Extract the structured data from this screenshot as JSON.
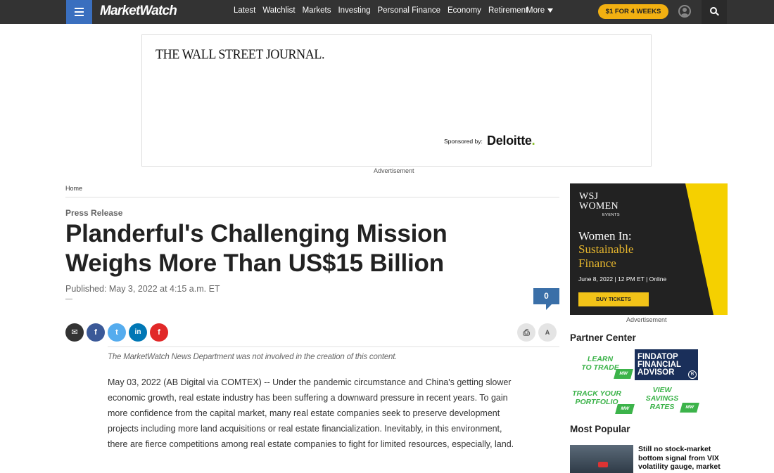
{
  "header": {
    "logo": "MarketWatch",
    "nav": [
      "Latest",
      "Watchlist",
      "Markets",
      "Investing",
      "Personal Finance",
      "Economy",
      "Retirement"
    ],
    "more_label": "More",
    "promo_label": "$1 FOR 4 WEEKS"
  },
  "top_ad": {
    "publisher": "THE WALL STREET JOURNAL.",
    "sponsored_by": "Sponsored by:",
    "sponsor": "Deloitte",
    "sponsor_dot": ".",
    "label": "Advertisement"
  },
  "article": {
    "breadcrumb": "Home",
    "kicker": "Press Release",
    "headline": "Planderful's Challenging Mission Weighs More Than US$15 Billion",
    "published": "Published: May 3, 2022 at 4:15 a.m. ET",
    "comment_count": "0",
    "share": {
      "email": "✉",
      "facebook": "f",
      "twitter": "t",
      "linkedin": "in",
      "flipboard": "f"
    },
    "tools": {
      "print": "⎙",
      "text_size": "A"
    },
    "disclaimer": "The MarketWatch News Department was not involved in the creation of this content.",
    "body": "May 03, 2022 (AB Digital via COMTEX) -- Under the pandemic circumstance and China's getting slower economic growth, real estate industry has been suffering a downward pressure in recent years. To gain more confidence from the capital market, many real estate companies seek to preserve development projects including more land acquisitions or real estate financialization. Inevitably, in this environment, there are fierce competitions among real estate companies to fight for limited resources, especially, land."
  },
  "rail_ad": {
    "brand_line1": "WSJ",
    "brand_line2": "WOMEN",
    "brand_line3": "EVENTS",
    "title": "Women In:",
    "subtitle_line1": "Sustainable",
    "subtitle_line2": "Finance",
    "date": "June 8, 2022 | 12 PM ET | Online",
    "cta": "BUY TICKETS",
    "label": "Advertisement"
  },
  "partner_center": {
    "title": "Partner Center",
    "items": [
      {
        "line1": "LEARN",
        "line2": "TO TRADE"
      },
      {
        "line1": "FINDATOP",
        "line2": "FINANCIAL",
        "line3": "ADVISOR"
      },
      {
        "line1": "TRACK YOUR",
        "line2": "PORTFOLIO"
      },
      {
        "line1": "VIEW",
        "line2": "SAVINGS",
        "line3": "RATES"
      }
    ],
    "badge": "MW"
  },
  "most_popular": {
    "title": "Most Popular",
    "first_item": "Still no stock-market bottom signal from VIX volatility gauge, market"
  },
  "colors": {
    "topbar": "#333333",
    "brand_blue": "#3a6fbf",
    "promo": "#f2b011",
    "partner_green": "#3cb34a",
    "event_yellow": "#f2c318"
  }
}
